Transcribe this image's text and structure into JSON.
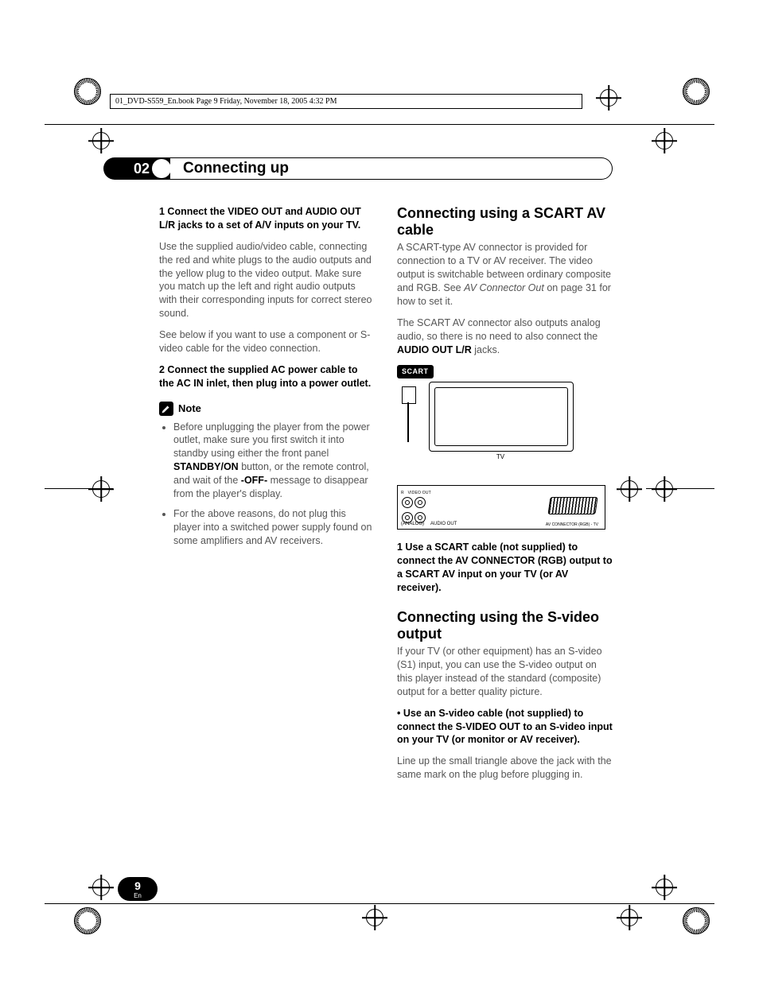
{
  "meta": {
    "header_line": "01_DVD-S559_En.book  Page 9  Friday, November 18, 2005  4:32 PM"
  },
  "chapter": {
    "number": "02",
    "title": "Connecting up"
  },
  "left": {
    "step1_head": "1    Connect the VIDEO OUT and AUDIO OUT L/R jacks to a set of A/V inputs on your TV.",
    "step1_body": "Use the supplied audio/video cable, connecting the red and white plugs to the audio outputs and the yellow plug to the video output. Make sure you match up the left and right audio outputs with their corresponding inputs for correct stereo sound.",
    "step1_below": "See below if you want to use a component or S-video cable for the video connection.",
    "step2_head": "2    Connect the supplied AC power cable to the AC IN inlet, then plug into a power outlet.",
    "note_label": "Note",
    "note_b1a": "Before unplugging the player from the power outlet, make sure you first switch it into standby using either the front panel ",
    "note_b1_strong1": "STANDBY/ON",
    "note_b1b": " button, or the remote control, and wait of the ",
    "note_b1_strong2": "-OFF-",
    "note_b1c": " message to disappear from the player's display.",
    "note_b2": "For the above reasons, do not plug this player into a switched power supply found on some amplifiers and AV receivers."
  },
  "right": {
    "h_scart": "Connecting using a SCART AV cable",
    "scart_p1a": "A SCART-type AV connector is provided for connection to a TV or AV receiver. The video output is switchable between ordinary composite and RGB. See ",
    "scart_p1_em": "AV Connector Out",
    "scart_p1b": " on page 31 for how to set it.",
    "scart_p2a": "The SCART AV connector also outputs analog audio, so there is no need to also connect the ",
    "scart_p2_strong": "AUDIO OUT L/R",
    "scart_p2b": " jacks.",
    "diagram_scart_label": "SCART",
    "diagram_tv_label": "TV",
    "panel_audio": "AUDIO OUT",
    "panel_analog": "(ANALOG)",
    "panel_av": "AV CONNECTOR (RGB) - TV",
    "scart_step1": "1    Use a SCART cable (not supplied) to connect the AV CONNECTOR (RGB) output to a SCART AV input on your TV (or AV receiver).",
    "h_svideo": "Connecting using the S-video output",
    "svideo_p1": "If your TV (or other equipment) has an S-video (S1) input, you can use the S-video output on this player instead of the standard (composite) output for a better quality picture.",
    "svideo_bullet": "•    Use an S-video cable (not supplied) to connect the S-VIDEO OUT to an S-video input on your TV (or monitor or AV receiver).",
    "svideo_p2": "Line up the small triangle above the jack with the same mark on the plug before plugging in."
  },
  "footer": {
    "page_number": "9",
    "lang": "En"
  }
}
